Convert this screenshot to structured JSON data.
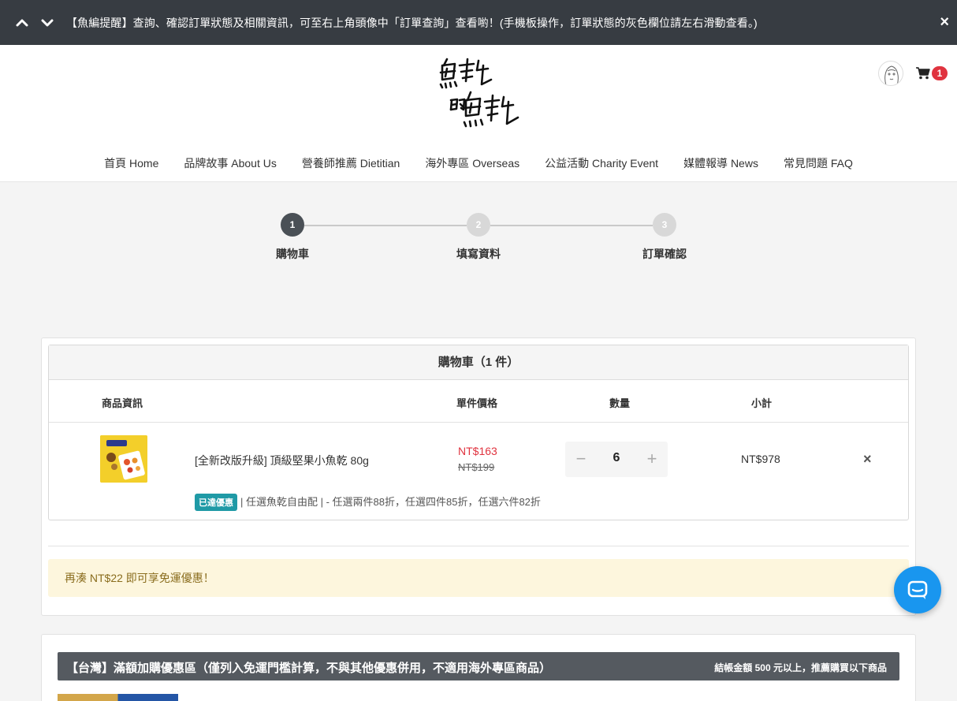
{
  "announcement": {
    "text": "【魚編提醒】查詢、確認訂單狀態及相關資訊，可至右上角頭像中「訂單查詢」查看喲！(手機板操作，訂單狀態的灰色欄位請左右滑動查看。)",
    "close_label": "×"
  },
  "header": {
    "cart_count": "1"
  },
  "nav": {
    "items": [
      "首頁 Home",
      "品牌故事 About Us",
      "營養師推薦 Dietitian",
      "海外專區 Overseas",
      "公益活動 Charity Event",
      "媒體報導 News",
      "常見問題 FAQ"
    ]
  },
  "steps": [
    {
      "num": "1",
      "label": "購物車"
    },
    {
      "num": "2",
      "label": "填寫資料"
    },
    {
      "num": "3",
      "label": "訂單確認"
    }
  ],
  "cart": {
    "title": "購物車（1 件）",
    "columns": {
      "info": "商品資訊",
      "unit_price": "單件價格",
      "qty": "數量",
      "subtotal": "小計"
    },
    "item": {
      "name": "[全新改版升級] 頂級堅果小魚乾 80g",
      "sale_price": "NT$163",
      "original_price": "NT$199",
      "quantity": "6",
      "subtotal": "NT$978",
      "promo_tag": "已達優惠",
      "promo_text": "| 任選魚乾自由配 | - 任選兩件88折，任選四件85折，任選六件82折"
    },
    "minus_label": "−",
    "plus_label": "+",
    "remove_label": "×"
  },
  "shipping_notice": "再湊 NT$22 即可享免運優惠！",
  "addon": {
    "title": "【台灣】滿額加購優惠區（僅列入免運門檻計算，不與其他優惠併用，不適用海外專區商品）",
    "note": "結帳金額 500 元以上，推薦購買以下商品"
  },
  "colors": {
    "announce_bg": "#373c42",
    "sale_red": "#e0333f",
    "badge_red": "#e0333f",
    "promo_teal": "#1f9aa6",
    "notice_bg": "#fdf6dd",
    "addon_bar": "#555a60",
    "chat_blue": "#1996ef"
  },
  "icons": {
    "up": "chevron-up-icon",
    "down": "chevron-down-icon",
    "cart": "cart-icon",
    "chat": "chat-icon"
  }
}
